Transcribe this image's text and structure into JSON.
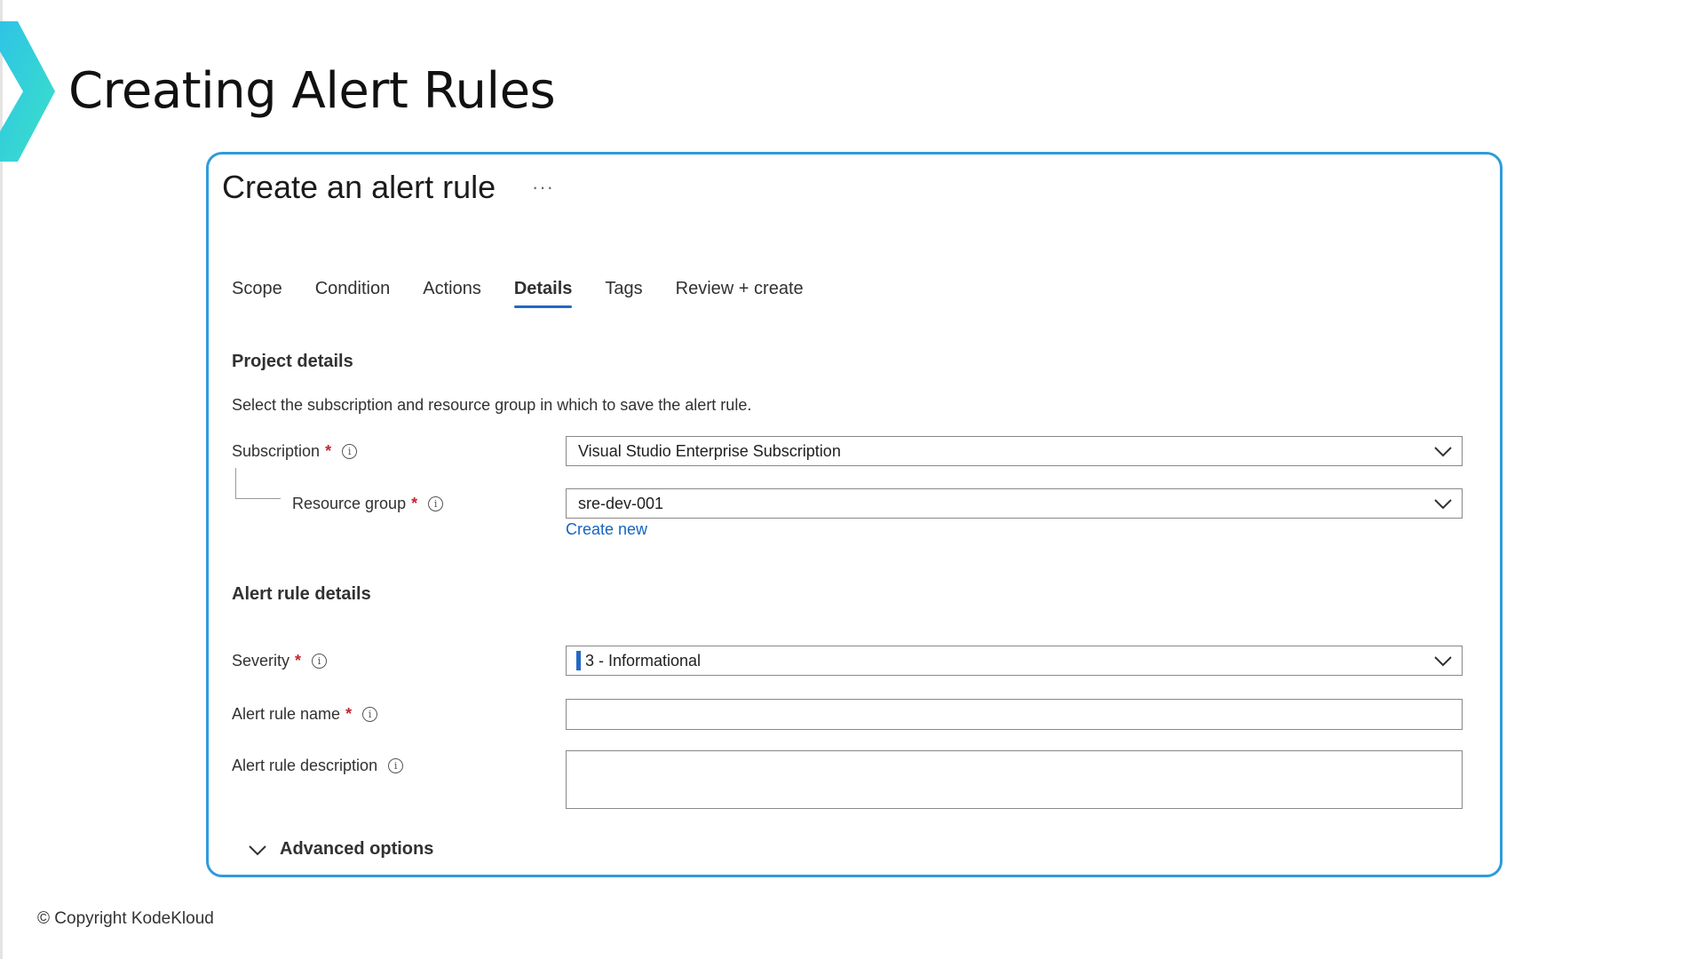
{
  "slide": {
    "title": "Creating Alert Rules",
    "copyright": "© Copyright KodeKloud"
  },
  "colors": {
    "accent": "#2f9bdc",
    "tab_underline": "#2369c4",
    "link": "#1565c0",
    "required": "#c4262e",
    "logo_gradient": [
      "#2ec4e6",
      "#3be0c8"
    ]
  },
  "panel": {
    "title": "Create an alert rule",
    "more_label": "···"
  },
  "tabs": [
    {
      "label": "Scope",
      "active": false
    },
    {
      "label": "Condition",
      "active": false
    },
    {
      "label": "Actions",
      "active": false
    },
    {
      "label": "Details",
      "active": true
    },
    {
      "label": "Tags",
      "active": false
    },
    {
      "label": "Review + create",
      "active": false
    }
  ],
  "project_details": {
    "heading": "Project details",
    "description": "Select the subscription and resource group in which to save the alert rule.",
    "subscription": {
      "label": "Subscription",
      "required_mark": "*",
      "info_icon": "info-circle-icon",
      "value": "Visual Studio Enterprise Subscription"
    },
    "resource_group": {
      "label": "Resource group",
      "required_mark": "*",
      "info_icon": "info-circle-icon",
      "value": "sre-dev-001"
    },
    "create_new_label": "Create new"
  },
  "alert_rule_details": {
    "heading": "Alert rule details",
    "severity": {
      "label": "Severity",
      "required_mark": "*",
      "value": "3 - Informational"
    },
    "name": {
      "label": "Alert rule name",
      "required_mark": "*",
      "value": ""
    },
    "description": {
      "label": "Alert rule description",
      "value": ""
    }
  },
  "advanced": {
    "label": "Advanced options",
    "expanded": false
  }
}
